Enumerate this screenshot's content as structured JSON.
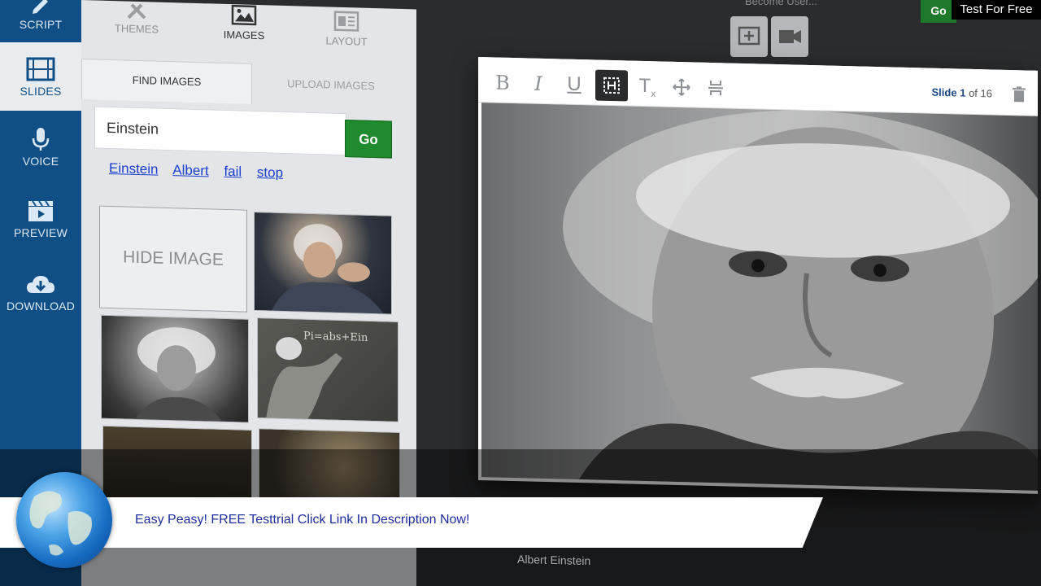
{
  "nav": {
    "items": [
      {
        "label": "SCRIPT",
        "icon": "pencil-icon"
      },
      {
        "label": "SLIDES",
        "icon": "film-icon"
      },
      {
        "label": "VOICE",
        "icon": "microphone-icon"
      },
      {
        "label": "PREVIEW",
        "icon": "clapperboard-icon"
      },
      {
        "label": "DOWNLOAD",
        "icon": "cloud-download-icon"
      }
    ]
  },
  "panel": {
    "top_tabs": [
      {
        "label": "THEMES",
        "icon": "tools-icon"
      },
      {
        "label": "IMAGES",
        "icon": "image-icon"
      },
      {
        "label": "LAYOUT",
        "icon": "layout-icon"
      }
    ],
    "sub_tabs": {
      "find": "FIND IMAGES",
      "upload": "UPLOAD IMAGES"
    },
    "search": {
      "value": "Einstein",
      "go_label": "Go"
    },
    "suggestions": [
      "Einstein",
      "Albert",
      "fail",
      "stop"
    ],
    "hide_image_label": "HIDE IMAGE"
  },
  "editor": {
    "tools": [
      {
        "label": "B",
        "icon": "bold-icon"
      },
      {
        "label": "I",
        "icon": "italic-icon"
      },
      {
        "label": "U",
        "icon": "underline-icon"
      },
      {
        "label": "",
        "icon": "frame-select-icon"
      },
      {
        "label": "T",
        "icon": "clear-format-icon"
      },
      {
        "label": "",
        "icon": "move-icon"
      },
      {
        "label": "",
        "icon": "distribute-icon"
      }
    ],
    "slide_counter": {
      "prefix": "Slide",
      "current": "1",
      "of": "of 16"
    },
    "caption": "Albert Einstein"
  },
  "topbar": {
    "input_text": "Become User...",
    "go_label": "Go"
  },
  "watermark": "Test For Free",
  "banner": {
    "text": "Easy Peasy! FREE Testtrial Click Link In Description Now!"
  },
  "colors": {
    "nav_bg": "#0f4f86",
    "go_green": "#1f8a2e",
    "link_blue": "#1a3fd1",
    "banner_text": "#1e2d9c"
  }
}
